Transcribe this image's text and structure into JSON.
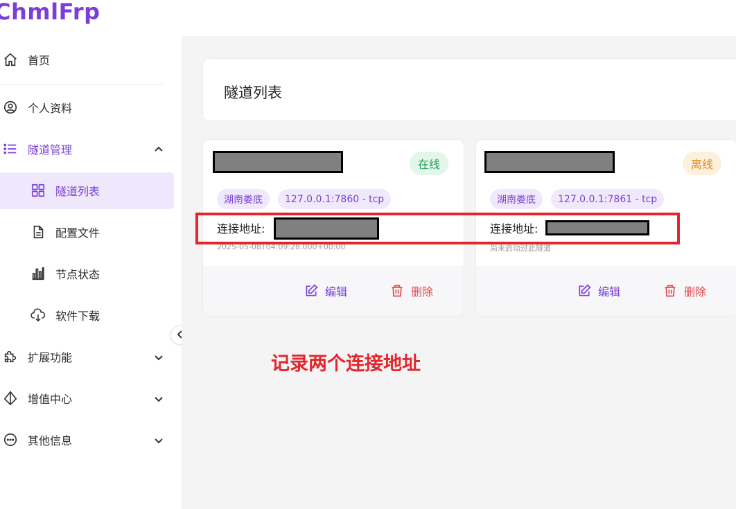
{
  "app": {
    "logo": "ChmlFrp"
  },
  "sidebar": {
    "items": [
      {
        "label": "首页",
        "icon": "home-icon"
      },
      {
        "label": "个人资料",
        "icon": "user-circle-icon"
      },
      {
        "label": "隧道管理",
        "icon": "list-icon",
        "expanded": true
      },
      {
        "label": "隧道列表",
        "icon": "grid-icon",
        "active": true
      },
      {
        "label": "配置文件",
        "icon": "file-icon"
      },
      {
        "label": "节点状态",
        "icon": "bar-chart-icon"
      },
      {
        "label": "软件下载",
        "icon": "cloud-download-icon"
      },
      {
        "label": "扩展功能",
        "icon": "puzzle-icon"
      },
      {
        "label": "增值中心",
        "icon": "diamond-icon"
      },
      {
        "label": "其他信息",
        "icon": "more-circle-icon"
      }
    ]
  },
  "page": {
    "title": "隧道列表"
  },
  "tunnels": [
    {
      "status": "在线",
      "region": "湖南娄底",
      "local": "127.0.0.1:7860 - tcp",
      "address_label": "连接地址:",
      "subtext": "2025-05-08T04:09:28.000+00:00",
      "edit": "编辑",
      "delete": "删除"
    },
    {
      "status": "离线",
      "region": "湖南娄底",
      "local": "127.0.0.1:7861 - tcp",
      "address_label": "连接地址:",
      "subtext": "尚未启动过此隧道",
      "edit": "编辑",
      "delete": "删除"
    }
  ],
  "annotation": {
    "text": "记录两个连接地址"
  },
  "colors": {
    "brand": "#7b3fd6",
    "online": "#1f9d55",
    "offline": "#e08a1e",
    "danger": "#e24b4b",
    "annotation": "#e3262d"
  }
}
